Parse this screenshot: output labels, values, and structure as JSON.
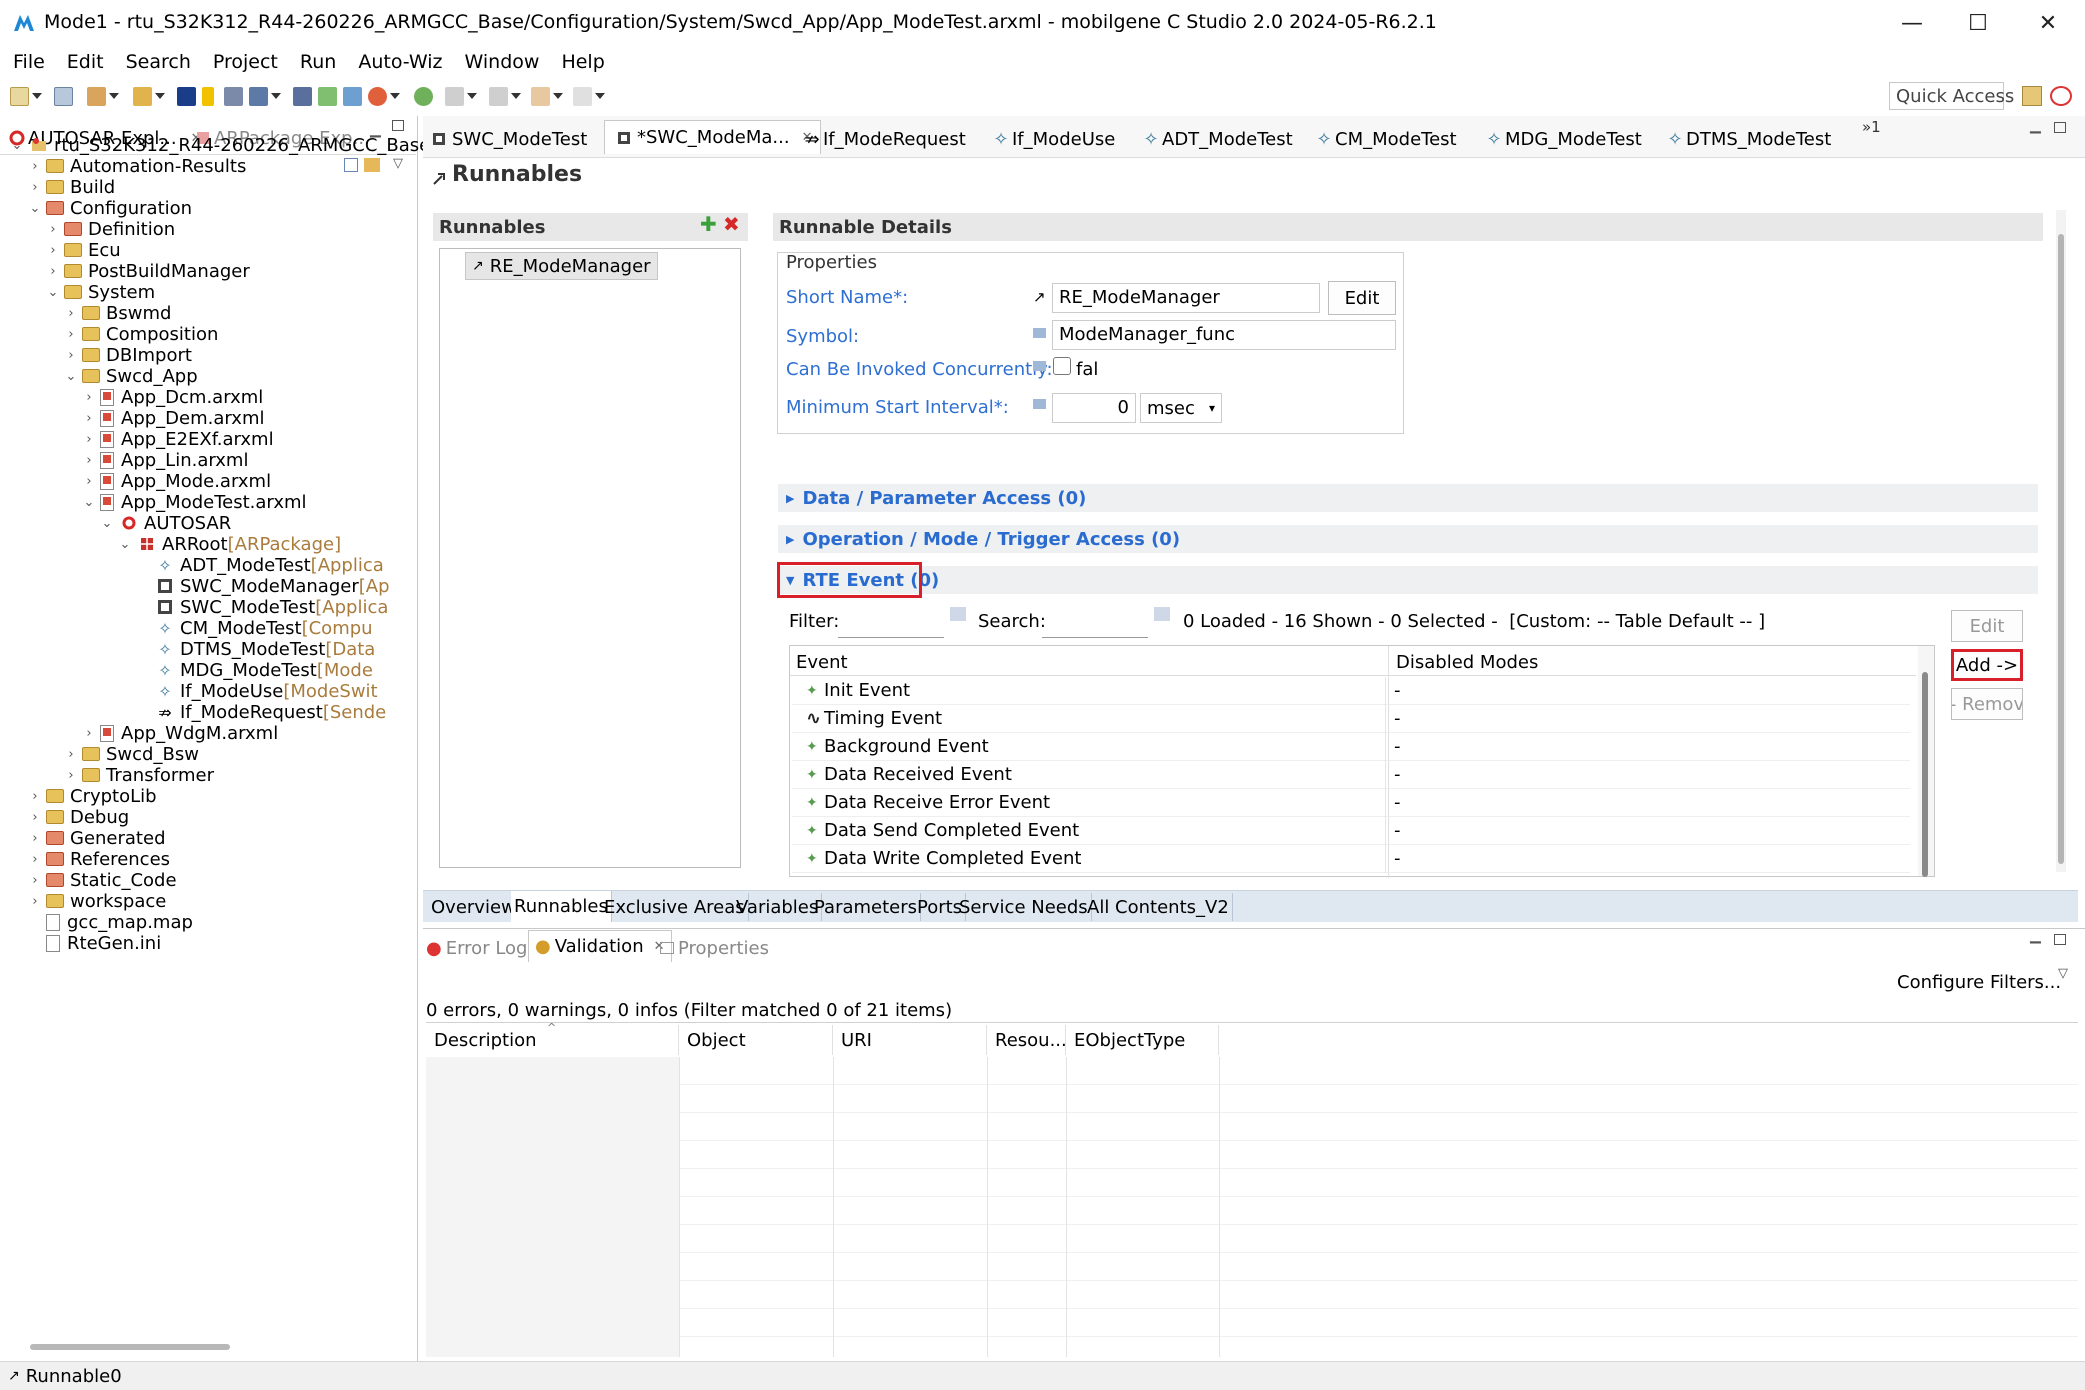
{
  "window": {
    "title": "Mode1 - rtu_S32K312_R44-260226_ARMGCC_Base/Configuration/System/Swcd_App/App_ModeTest.arxml - mobilgene C Studio 2.0 2024-05-R6.2.1",
    "minimize": "—",
    "maximize": "☐",
    "close": "✕"
  },
  "menu": [
    "File",
    "Edit",
    "Search",
    "Project",
    "Run",
    "Auto-Wiz",
    "Window",
    "Help"
  ],
  "toolbar": {
    "quick_access": "Quick Access"
  },
  "left_panel": {
    "tabs": [
      {
        "label": "AUTOSAR Expl...",
        "active": true
      },
      {
        "label": "ARPackage Exp...",
        "active": false
      }
    ],
    "tree": [
      {
        "label": "rtu_S32K312_R44-260226_ARMGCC_Base",
        "tail": "",
        "depth": 0,
        "expand": "v",
        "icon": "project"
      },
      {
        "label": "Automation-Results",
        "tail": "",
        "depth": 1,
        "expand": ">",
        "icon": "folder"
      },
      {
        "label": "Build",
        "tail": "",
        "depth": 1,
        "expand": ">",
        "icon": "folder"
      },
      {
        "label": "Configuration",
        "tail": "",
        "depth": 1,
        "expand": "v",
        "icon": "folder-red"
      },
      {
        "label": "Definition",
        "tail": "",
        "depth": 2,
        "expand": ">",
        "icon": "folder-red"
      },
      {
        "label": "Ecu",
        "tail": "",
        "depth": 2,
        "expand": ">",
        "icon": "folder"
      },
      {
        "label": "PostBuildManager",
        "tail": "",
        "depth": 2,
        "expand": ">",
        "icon": "folder"
      },
      {
        "label": "System",
        "tail": "",
        "depth": 2,
        "expand": "v",
        "icon": "folder"
      },
      {
        "label": "Bswmd",
        "tail": "",
        "depth": 3,
        "expand": ">",
        "icon": "folder"
      },
      {
        "label": "Composition",
        "tail": "",
        "depth": 3,
        "expand": ">",
        "icon": "folder"
      },
      {
        "label": "DBImport",
        "tail": "",
        "depth": 3,
        "expand": ">",
        "icon": "folder"
      },
      {
        "label": "Swcd_App",
        "tail": "",
        "depth": 3,
        "expand": "v",
        "icon": "folder"
      },
      {
        "label": "App_Dcm.arxml",
        "tail": "",
        "depth": 4,
        "expand": ">",
        "icon": "file-red"
      },
      {
        "label": "App_Dem.arxml",
        "tail": "",
        "depth": 4,
        "expand": ">",
        "icon": "file-red"
      },
      {
        "label": "App_E2EXf.arxml",
        "tail": "",
        "depth": 4,
        "expand": ">",
        "icon": "file-red"
      },
      {
        "label": "App_Lin.arxml",
        "tail": "",
        "depth": 4,
        "expand": ">",
        "icon": "file-red"
      },
      {
        "label": "App_Mode.arxml",
        "tail": "",
        "depth": 4,
        "expand": ">",
        "icon": "file-red"
      },
      {
        "label": "App_ModeTest.arxml",
        "tail": "",
        "depth": 4,
        "expand": "v",
        "icon": "file-red"
      },
      {
        "label": "AUTOSAR",
        "tail": "",
        "depth": 5,
        "expand": "v",
        "icon": "autosar"
      },
      {
        "label": "ARRoot",
        "tail": " [ARPackage]",
        "depth": 6,
        "expand": "v",
        "icon": "package"
      },
      {
        "label": "ADT_ModeTest",
        "tail": " [Applica",
        "depth": 7,
        "expand": "",
        "icon": "element"
      },
      {
        "label": "SWC_ModeManager",
        "tail": " [Ap",
        "depth": 7,
        "expand": "",
        "icon": "swc"
      },
      {
        "label": "SWC_ModeTest",
        "tail": " [Applica",
        "depth": 7,
        "expand": "",
        "icon": "swc"
      },
      {
        "label": "CM_ModeTest",
        "tail": " [Compu",
        "depth": 7,
        "expand": "",
        "icon": "element"
      },
      {
        "label": "DTMS_ModeTest",
        "tail": " [Data",
        "depth": 7,
        "expand": "",
        "icon": "element"
      },
      {
        "label": "MDG_ModeTest",
        "tail": " [Mode",
        "depth": 7,
        "expand": "",
        "icon": "element"
      },
      {
        "label": "If_ModeUse",
        "tail": " [ModeSwit",
        "depth": 7,
        "expand": "",
        "icon": "element"
      },
      {
        "label": "If_ModeRequest",
        "tail": " [Sende",
        "depth": 7,
        "expand": "",
        "icon": "interface"
      },
      {
        "label": "App_WdgM.arxml",
        "tail": "",
        "depth": 4,
        "expand": ">",
        "icon": "file-red"
      },
      {
        "label": "Swcd_Bsw",
        "tail": "",
        "depth": 3,
        "expand": ">",
        "icon": "folder"
      },
      {
        "label": "Transformer",
        "tail": "",
        "depth": 3,
        "expand": ">",
        "icon": "folder"
      },
      {
        "label": "CryptoLib",
        "tail": "",
        "depth": 1,
        "expand": ">",
        "icon": "folder"
      },
      {
        "label": "Debug",
        "tail": "",
        "depth": 1,
        "expand": ">",
        "icon": "folder"
      },
      {
        "label": "Generated",
        "tail": "",
        "depth": 1,
        "expand": ">",
        "icon": "folder-red"
      },
      {
        "label": "References",
        "tail": "",
        "depth": 1,
        "expand": ">",
        "icon": "folder-red"
      },
      {
        "label": "Static_Code",
        "tail": "",
        "depth": 1,
        "expand": ">",
        "icon": "folder-red"
      },
      {
        "label": "workspace",
        "tail": "",
        "depth": 1,
        "expand": ">",
        "icon": "folder"
      },
      {
        "label": "gcc_map.map",
        "tail": "",
        "depth": 1,
        "expand": "",
        "icon": "file"
      },
      {
        "label": "RteGen.ini",
        "tail": "",
        "depth": 1,
        "expand": "",
        "icon": "file"
      }
    ]
  },
  "editor_tabs": [
    {
      "label": "SWC_ModeTest",
      "active": false,
      "closable": false
    },
    {
      "label": "*SWC_ModeMa...",
      "active": true,
      "closable": true
    },
    {
      "label": "If_ModeRequest",
      "active": false,
      "closable": false
    },
    {
      "label": "If_ModeUse",
      "active": false,
      "closable": false
    },
    {
      "label": "ADT_ModeTest",
      "active": false,
      "closable": false
    },
    {
      "label": "CM_ModeTest",
      "active": false,
      "closable": false
    },
    {
      "label": "MDG_ModeTest",
      "active": false,
      "closable": false
    },
    {
      "label": "DTMS_ModeTest",
      "active": false,
      "closable": false
    }
  ],
  "editor_overflow": "»1",
  "page": {
    "title": "Runnables",
    "runnables_header": "Runnables",
    "runnables_list": [
      "RE_ModeManager"
    ],
    "details_header": "Runnable Details",
    "properties_label": "Properties",
    "short_name_label": "Short Name*:",
    "short_name_value": "RE_ModeManager",
    "edit_button": "Edit",
    "symbol_label": "Symbol:",
    "symbol_value": "ModeManager_func",
    "concurrent_label": "Can Be Invoked Concurrently:",
    "concurrent_value": "fal",
    "min_interval_label": "Minimum Start Interval*:",
    "min_interval_value": "0",
    "min_interval_unit": "msec",
    "sections": {
      "data_access": "Data / Parameter Access (0)",
      "operation_access": "Operation / Mode / Trigger Access (0)",
      "rte_event": "RTE Event (0)"
    },
    "filter_label": "Filter:",
    "search_label": "Search:",
    "filter_status": "0 Loaded - 16 Shown - 0 Selected -  [Custom: -- Table Default -- ]",
    "table_headers": [
      "Event",
      "Disabled Modes"
    ],
    "events": [
      {
        "name": "Init Event",
        "modes": "-",
        "icon": "plus"
      },
      {
        "name": "Timing Event",
        "modes": "-",
        "icon": "timing"
      },
      {
        "name": "Background Event",
        "modes": "-",
        "icon": "plus"
      },
      {
        "name": "Data Received Event",
        "modes": "-",
        "icon": "plus"
      },
      {
        "name": "Data Receive Error Event",
        "modes": "-",
        "icon": "plus"
      },
      {
        "name": "Data Send Completed Event",
        "modes": "-",
        "icon": "plus"
      },
      {
        "name": "Data Write Completed Event",
        "modes": "-",
        "icon": "plus"
      }
    ],
    "side_buttons": {
      "edit": "Edit",
      "add": "Add ->",
      "remove": "- Remov"
    }
  },
  "editor_bottom_tabs": [
    {
      "label": "Overview",
      "active": false
    },
    {
      "label": "Runnables",
      "active": true
    },
    {
      "label": "Exclusive Areas",
      "active": false
    },
    {
      "label": "Variables",
      "active": false
    },
    {
      "label": "Parameters",
      "active": false
    },
    {
      "label": "Ports",
      "active": false
    },
    {
      "label": "Service Needs",
      "active": false
    },
    {
      "label": "All Contents_V2",
      "active": false
    }
  ],
  "bottom_panel": {
    "tabs": [
      {
        "label": "Error Log",
        "active": false
      },
      {
        "label": "Validation",
        "active": true
      },
      {
        "label": "Properties",
        "active": false
      }
    ],
    "configure_filters": "Configure Filters...",
    "summary": "0 errors, 0 warnings, 0 infos (Filter matched 0 of 21 items)",
    "columns": [
      "Description",
      "Object",
      "URI",
      "Resou...",
      "EObjectType"
    ]
  },
  "status": {
    "text": "Runnable0"
  },
  "colors": {
    "highlight": "#d9202a",
    "link": "#2e6fd1",
    "section": "#e8e8e8"
  }
}
